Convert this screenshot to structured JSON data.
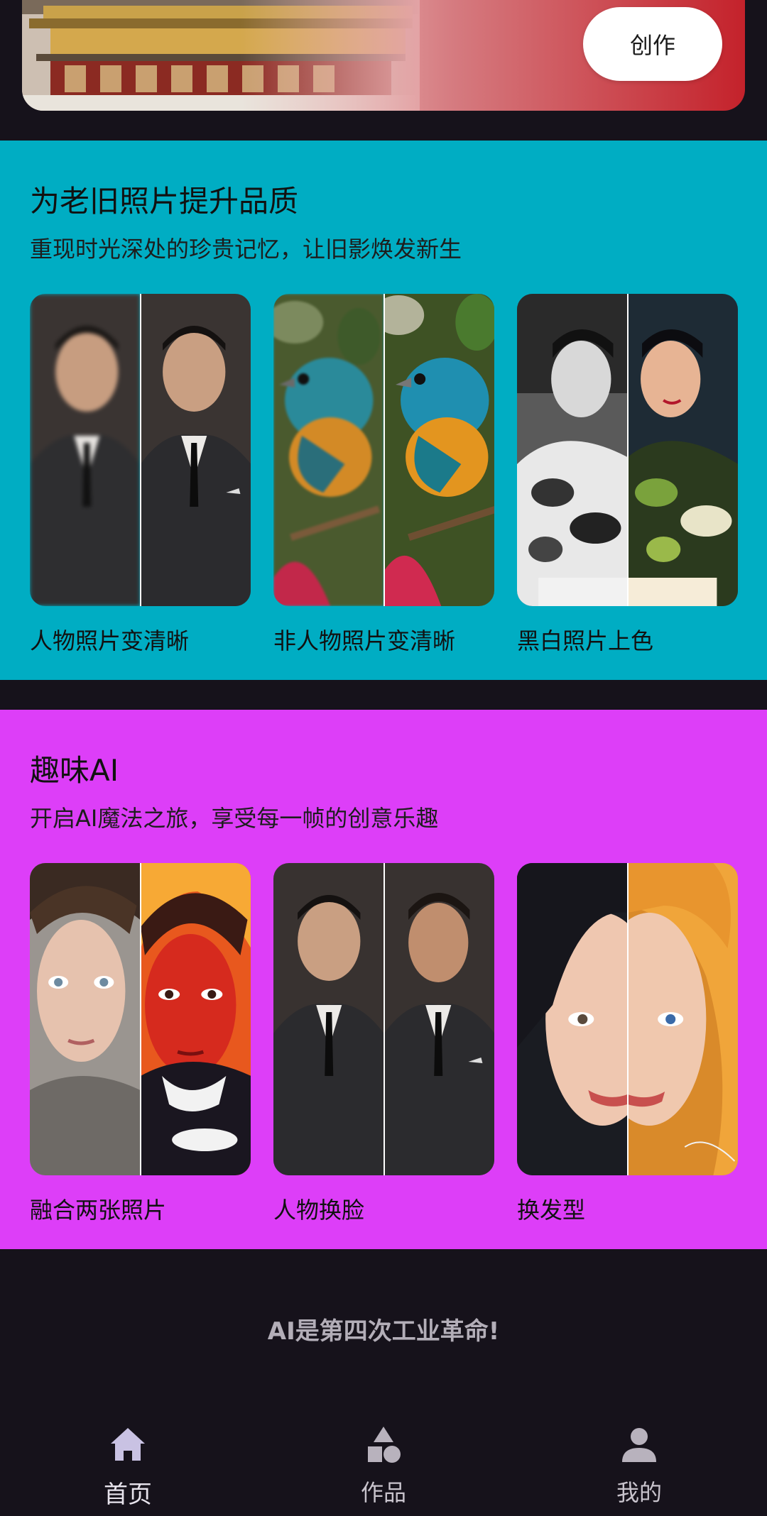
{
  "banner": {
    "create_label": "创作"
  },
  "restore_section": {
    "title": "为老旧照片提升品质",
    "subtitle": "重现时光深处的珍贵记忆，让旧影焕发新生",
    "cards": [
      {
        "label": "人物照片变清晰"
      },
      {
        "label": "非人物照片变清晰"
      },
      {
        "label": "黑白照片上色"
      }
    ]
  },
  "fun_section": {
    "title": "趣味AI",
    "subtitle": "开启AI魔法之旅，享受每一帧的创意乐趣",
    "cards": [
      {
        "label": "融合两张照片"
      },
      {
        "label": "人物换脸"
      },
      {
        "label": "换发型"
      }
    ]
  },
  "tagline": "AI是第四次工业革命!",
  "bottom_nav": {
    "items": [
      {
        "label": "首页",
        "icon": "home-icon",
        "active": true
      },
      {
        "label": "作品",
        "icon": "shapes-icon",
        "active": false
      },
      {
        "label": "我的",
        "icon": "person-icon",
        "active": false
      }
    ]
  },
  "colors": {
    "restore_bg": "#00adc3",
    "fun_bg": "#dd3ef8",
    "page_bg": "#16121b",
    "banner_accent": "#c4222b"
  }
}
